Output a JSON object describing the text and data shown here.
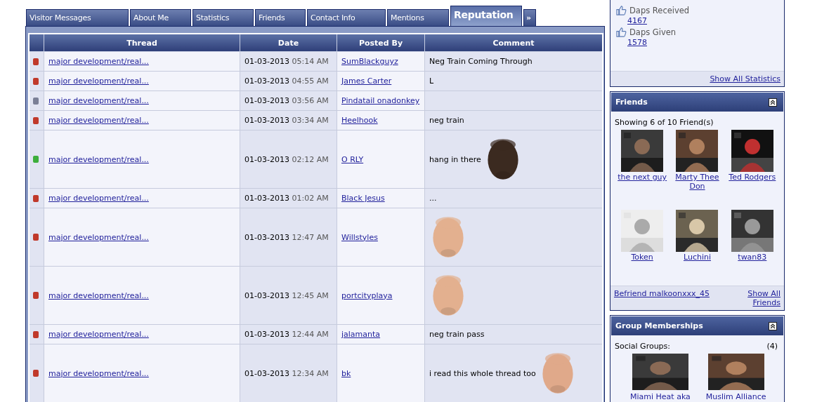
{
  "tabs": [
    {
      "label": "Visitor Messages",
      "selected": false
    },
    {
      "label": "About Me",
      "selected": false
    },
    {
      "label": "Statistics",
      "selected": false
    },
    {
      "label": "Friends",
      "selected": false
    },
    {
      "label": "Contact Info",
      "selected": false
    },
    {
      "label": "Mentions",
      "selected": false
    },
    {
      "label": "Reputation",
      "selected": true
    },
    {
      "label": "»",
      "selected": false
    }
  ],
  "table": {
    "columns": [
      "Thread",
      "Date",
      "Posted By",
      "Comment"
    ],
    "rows": [
      {
        "color": "#c0392b",
        "thread": "major development/real...",
        "date": "01-03-2013",
        "time": "05:14 AM",
        "posted_by": "SumBlackguyz",
        "comment": "Neg Train Coming Through"
      },
      {
        "color": "#c0392b",
        "thread": "major development/real...",
        "date": "01-03-2013",
        "time": "04:55 AM",
        "posted_by": "James Carter",
        "comment": "L"
      },
      {
        "color": "#7a7f96",
        "thread": "major development/real...",
        "date": "01-03-2013",
        "time": "03:56 AM",
        "posted_by": "Pindatail onadonkey"
      },
      {
        "color": "#c0392b",
        "thread": "major development/real...",
        "date": "01-03-2013",
        "time": "03:34 AM",
        "posted_by": "Heelhook",
        "comment": "neg train"
      },
      {
        "color": "#3cae3c",
        "thread": "major development/real...",
        "date": "01-03-2013",
        "time": "02:12 AM",
        "posted_by": "O RLY",
        "comment": "hang in there"
      },
      {
        "color": "#c0392b",
        "thread": "major development/real...",
        "date": "01-03-2013",
        "time": "01:02 AM",
        "posted_by": "Black Jesus",
        "comment": "..."
      },
      {
        "color": "#c0392b",
        "thread": "major development/real...",
        "date": "01-03-2013",
        "time": "12:47 AM",
        "posted_by": "Willstyles"
      },
      {
        "color": "#c0392b",
        "thread": "major development/real...",
        "date": "01-03-2013",
        "time": "12:45 AM",
        "posted_by": "portcityplaya"
      },
      {
        "color": "#c0392b",
        "thread": "major development/real...",
        "date": "01-03-2013",
        "time": "12:44 AM",
        "posted_by": "jalamanta",
        "comment": "neg train pass"
      },
      {
        "color": "#c0392b",
        "thread": "major development/real...",
        "date": "01-03-2013",
        "time": "12:34 AM",
        "posted_by": "bk",
        "comment": "i read this whole thread too"
      }
    ]
  },
  "statistics": {
    "items": [
      {
        "label": "Daps Received",
        "value": "4167"
      },
      {
        "label": "Daps Given",
        "value": "1578"
      }
    ],
    "footer_link": "Show All Statistics"
  },
  "friends": {
    "title": "Friends",
    "summary": "Showing 6 of 10 Friend(s)",
    "items": [
      {
        "name": "the next guy"
      },
      {
        "name": "Marty Thee Don"
      },
      {
        "name": "Ted Rodgers"
      },
      {
        "name": "Token"
      },
      {
        "name": "Luchini"
      },
      {
        "name": "twan83"
      }
    ],
    "befriend_link": "Befriend malkoonxxx_45",
    "show_all_link": "Show All Friends"
  },
  "groups": {
    "title": "Group Memberships",
    "label": "Social Groups:",
    "count": "(4)",
    "items": [
      {
        "name": "Miami Heat aka"
      },
      {
        "name": "Muslim Alliance"
      }
    ]
  }
}
